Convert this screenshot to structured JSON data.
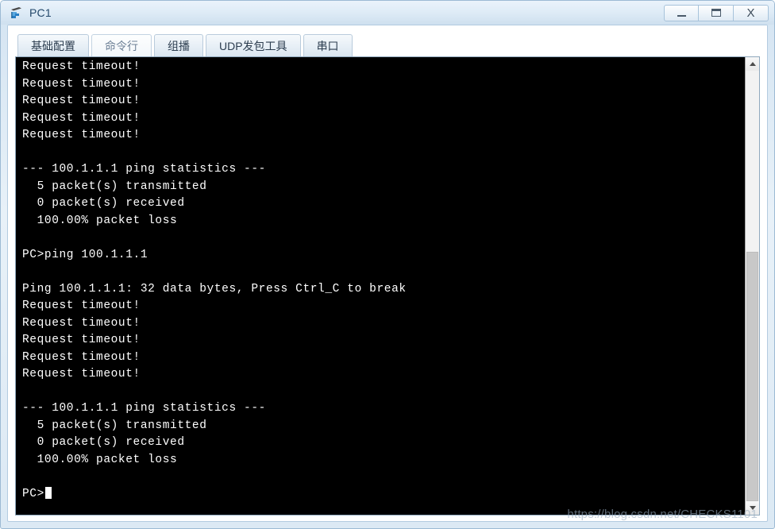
{
  "window": {
    "title": "PC1",
    "icon": "pc-device-icon",
    "controls": [
      {
        "name": "minimize-button",
        "label": "—",
        "icon": "minimize-icon"
      },
      {
        "name": "maximize-button",
        "label": "□",
        "icon": "maximize-icon"
      },
      {
        "name": "close-button",
        "label": "X",
        "icon": "close-icon"
      }
    ]
  },
  "tabs": [
    {
      "label": "基础配置",
      "active": false
    },
    {
      "label": "命令行",
      "active": true
    },
    {
      "label": "组播",
      "active": false
    },
    {
      "label": "UDP发包工具",
      "active": false
    },
    {
      "label": "串口",
      "active": false
    }
  ],
  "terminal": {
    "lines": [
      "Request timeout!",
      "Request timeout!",
      "Request timeout!",
      "Request timeout!",
      "Request timeout!",
      "",
      "--- 100.1.1.1 ping statistics ---",
      "  5 packet(s) transmitted",
      "  0 packet(s) received",
      "  100.00% packet loss",
      "",
      "PC>ping 100.1.1.1",
      "",
      "Ping 100.1.1.1: 32 data bytes, Press Ctrl_C to break",
      "Request timeout!",
      "Request timeout!",
      "Request timeout!",
      "Request timeout!",
      "Request timeout!",
      "",
      "--- 100.1.1.1 ping statistics ---",
      "  5 packet(s) transmitted",
      "  0 packet(s) received",
      "  100.00% packet loss",
      ""
    ],
    "prompt": "PC>",
    "background": "#000000",
    "foreground": "#ffffff"
  },
  "scrollbar": {
    "up_arrow": "chevron-up-icon",
    "down_arrow": "chevron-down-icon",
    "thumb_top_percent": 42,
    "thumb_height_percent": 58
  },
  "watermark": {
    "text": "https://blog.csdn.net/CHECKS1101"
  }
}
